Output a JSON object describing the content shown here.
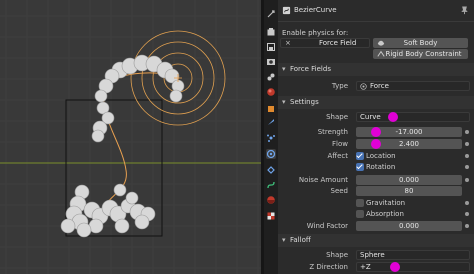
{
  "object": {
    "name": "BezierCurve"
  },
  "physics": {
    "heading": "Enable physics for:",
    "close_glyph": "×",
    "force_field_label": "Force Field",
    "soft_body_label": "Soft Body",
    "rigid_body_constraint_label": "Rigid Body Constraint"
  },
  "force_fields": {
    "title": "Force Fields",
    "type_label": "Type",
    "type_value": "Force"
  },
  "settings": {
    "title": "Settings",
    "shape_label": "Shape",
    "shape_value": "Curve",
    "strength_label": "Strength",
    "strength_value": "-17.000",
    "flow_label": "Flow",
    "flow_value": "2.400",
    "affect_label": "Affect",
    "location_label": "Location",
    "location_checked": true,
    "rotation_label": "Rotation",
    "rotation_checked": true,
    "noise_label": "Noise Amount",
    "noise_value": "0.000",
    "seed_label": "Seed",
    "seed_value": "80",
    "gravitation_label": "Gravitation",
    "gravitation_checked": false,
    "absorption_label": "Absorption",
    "absorption_checked": false,
    "wind_label": "Wind Factor",
    "wind_value": "0.000"
  },
  "falloff": {
    "title": "Falloff",
    "shape_label": "Shape",
    "shape_value": "Sphere",
    "zdir_label": "Z Direction",
    "zdir_value": "+Z"
  },
  "colors": {
    "accent_blue": "#4772b3",
    "annotation_pink": "#e100d5",
    "curve_orange": "#e8a050",
    "panel_bg": "#2b2b2b",
    "viewport_bg": "#393939"
  }
}
